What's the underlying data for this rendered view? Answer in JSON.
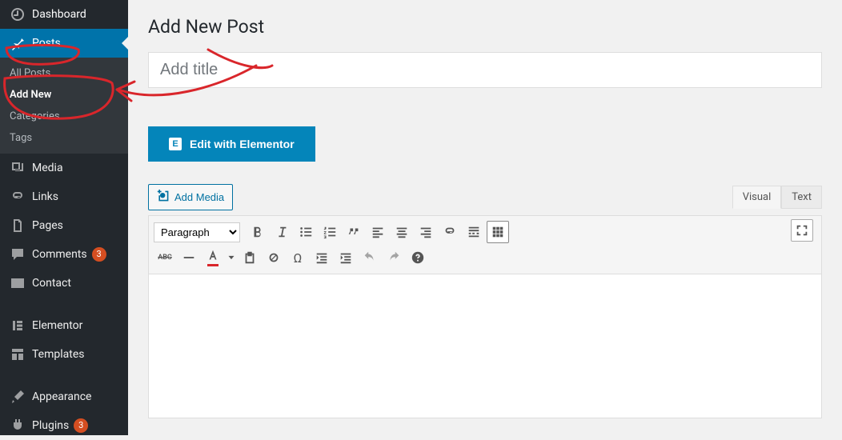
{
  "page": {
    "title": "Add New Post",
    "title_placeholder": "Add title"
  },
  "sidebar": {
    "dashboard": "Dashboard",
    "posts": "Posts",
    "posts_sub": {
      "all_posts": "All Posts",
      "add_new": "Add New",
      "categories": "Categories",
      "tags": "Tags"
    },
    "media": "Media",
    "links": "Links",
    "pages": "Pages",
    "comments": "Comments",
    "comments_badge": "3",
    "contact": "Contact",
    "elementor": "Elementor",
    "templates": "Templates",
    "appearance": "Appearance",
    "plugins": "Plugins",
    "plugins_badge": "3"
  },
  "elementor": {
    "button_label": "Edit with Elementor",
    "icon_glyph": "E"
  },
  "editor": {
    "add_media": "Add Media",
    "tabs": {
      "visual": "Visual",
      "text": "Text"
    },
    "format_select": "Paragraph"
  }
}
